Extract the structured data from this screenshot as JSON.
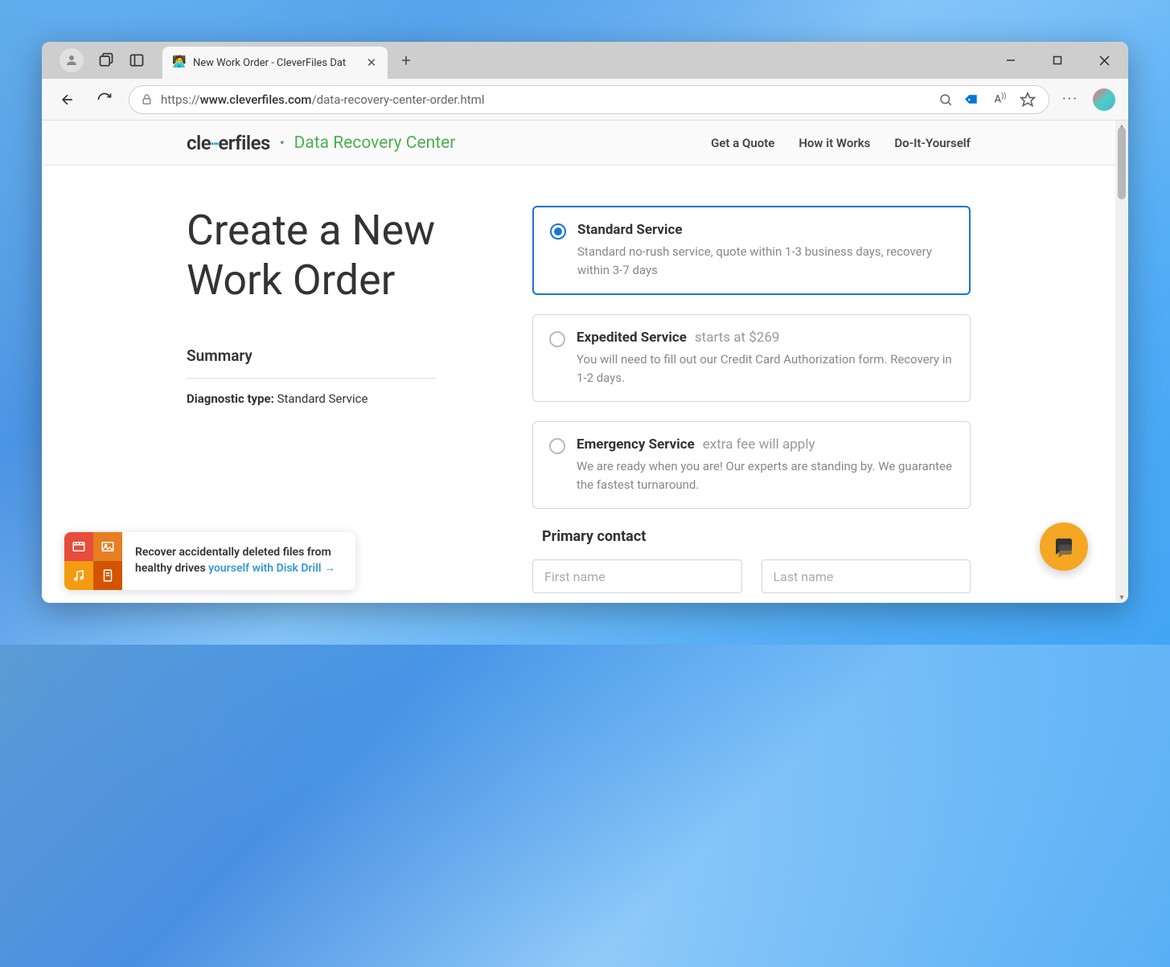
{
  "browser": {
    "tab_title": "New Work Order - CleverFiles Dat",
    "url_protocol": "https://",
    "url_domain": "www.cleverfiles.com",
    "url_path": "/data-recovery-center-order.html"
  },
  "header": {
    "logo_prefix": "cle",
    "logo_mid": "•••",
    "logo_suffix": "erfiles",
    "logo_sep": "•",
    "subtitle": "Data Recovery Center",
    "nav": [
      {
        "label": "Get a Quote"
      },
      {
        "label": "How it Works"
      },
      {
        "label": "Do-It-Yourself"
      }
    ]
  },
  "page": {
    "title": "Create a New Work Order",
    "summary_heading": "Summary",
    "summary_label": "Diagnostic type:",
    "summary_value": "Standard Service"
  },
  "services": [
    {
      "title": "Standard Service",
      "price": "",
      "desc": "Standard no-rush service, quote within 1-3 business days, recovery within 3-7 days",
      "selected": true
    },
    {
      "title": "Expedited Service",
      "price": "starts at $269",
      "desc": "You will need to fill out our Credit Card Authorization form. Recovery in 1-2 days.",
      "selected": false
    },
    {
      "title": "Emergency Service",
      "price": "extra fee will apply",
      "desc": "We are ready when you are! Our experts are standing by. We guarantee the fastest turnaround.",
      "selected": false
    }
  ],
  "contact": {
    "heading": "Primary contact",
    "first_name_placeholder": "First name",
    "last_name_placeholder": "Last name"
  },
  "promo": {
    "text_before": "Recover accidentally deleted files from healthy drives ",
    "link_text": "yourself with Disk Drill →"
  }
}
